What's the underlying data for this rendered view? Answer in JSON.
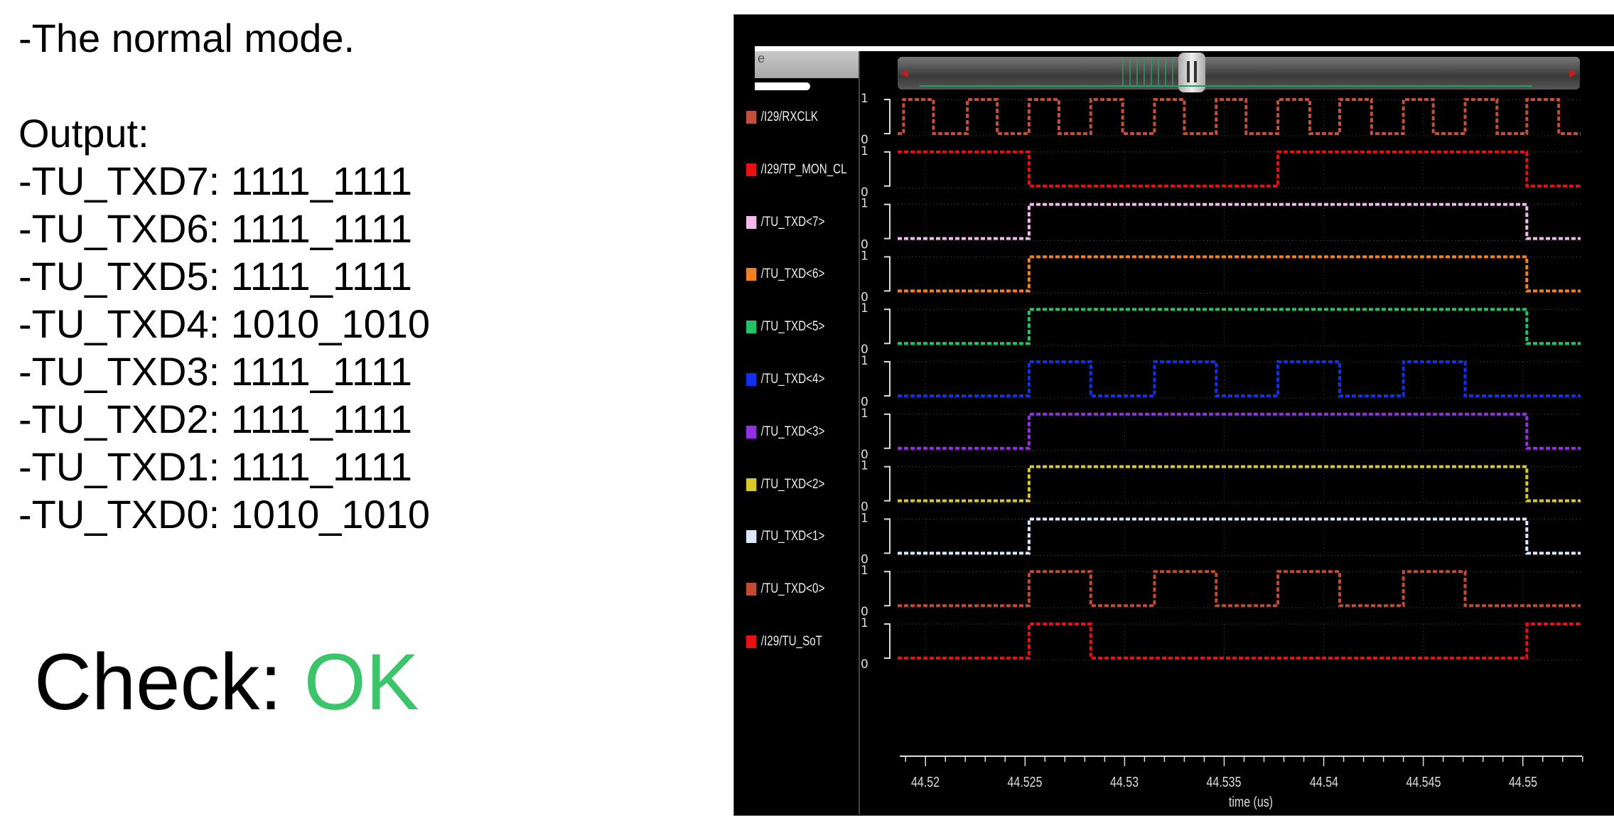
{
  "notes": {
    "mode": "-The normal mode.",
    "output_heading": "Output:",
    "lines": [
      "-TU_TXD7: 1111_1111",
      "-TU_TXD6: 1111_1111",
      "-TU_TXD5: 1111_1111",
      "-TU_TXD4: 1010_1010",
      "-TU_TXD3: 1111_1111",
      "-TU_TXD2: 1111_1111",
      "-TU_TXD1: 1111_1111",
      "-TU_TXD0: 1010_1010"
    ],
    "check_label": "Check:",
    "check_value": "OK"
  },
  "waveform": {
    "name_header": "e",
    "level_high": "1",
    "level_low": "0",
    "x_axis_label": "time (us)",
    "x_ticks": [
      "44.52",
      "44.525",
      "44.53",
      "44.535",
      "44.54",
      "44.545",
      "44.55"
    ],
    "x_tick_values": [
      44.52,
      44.525,
      44.53,
      44.535,
      44.54,
      44.545,
      44.55
    ],
    "view_range_us": [
      44.5186,
      44.5529
    ],
    "signals": [
      {
        "name": "/I29/RXCLK",
        "color": "#c0503a",
        "initial": 0,
        "transitions": [
          44.5189,
          44.5204,
          44.5221,
          44.5236,
          44.5252,
          44.5267,
          44.5283,
          44.5299,
          44.5315,
          44.533,
          44.5346,
          44.5361,
          44.5377,
          44.5393,
          44.5408,
          44.5424,
          44.544,
          44.5455,
          44.5471,
          44.5487,
          44.5502,
          44.5518
        ]
      },
      {
        "name": "/I29/TP_MON_CL",
        "color": "#e81010",
        "initial": 1,
        "transitions": [
          44.5252,
          44.5377,
          44.5502
        ]
      },
      {
        "name": "/TU_TXD<7>",
        "color": "#f4b8ec",
        "initial": 0,
        "transitions": [
          44.5252,
          44.5502
        ]
      },
      {
        "name": "/TU_TXD<6>",
        "color": "#f08020",
        "initial": 0,
        "transitions": [
          44.5252,
          44.5502
        ]
      },
      {
        "name": "/TU_TXD<5>",
        "color": "#22c466",
        "initial": 0,
        "transitions": [
          44.5252,
          44.5502
        ]
      },
      {
        "name": "/TU_TXD<4>",
        "color": "#1030f0",
        "initial": 0,
        "transitions": [
          44.5252,
          44.5283,
          44.5315,
          44.5346,
          44.5377,
          44.5408,
          44.544,
          44.5471
        ]
      },
      {
        "name": "/TU_TXD<3>",
        "color": "#9430e4",
        "initial": 0,
        "transitions": [
          44.5252,
          44.5502
        ]
      },
      {
        "name": "/TU_TXD<2>",
        "color": "#d8c828",
        "initial": 0,
        "transitions": [
          44.5252,
          44.5502
        ]
      },
      {
        "name": "/TU_TXD<1>",
        "color": "#dce8ff",
        "initial": 0,
        "transitions": [
          44.5252,
          44.5502
        ]
      },
      {
        "name": "/TU_TXD<0>",
        "color": "#c04a34",
        "initial": 0,
        "transitions": [
          44.5252,
          44.5283,
          44.5315,
          44.5346,
          44.5377,
          44.5408,
          44.544,
          44.5471
        ]
      },
      {
        "name": "/I29/TU_SoT",
        "color": "#e81010",
        "initial": 0,
        "transitions": [
          44.5252,
          44.5283,
          44.5502
        ]
      }
    ]
  }
}
